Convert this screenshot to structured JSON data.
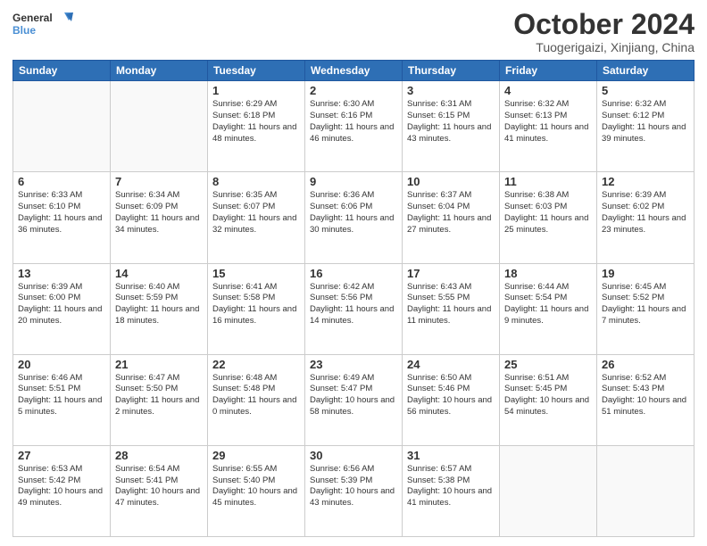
{
  "header": {
    "logo_line1": "General",
    "logo_line2": "Blue",
    "month": "October 2024",
    "location": "Tuogerigaizi, Xinjiang, China"
  },
  "days": [
    "Sunday",
    "Monday",
    "Tuesday",
    "Wednesday",
    "Thursday",
    "Friday",
    "Saturday"
  ],
  "weeks": [
    [
      {
        "num": "",
        "text": ""
      },
      {
        "num": "",
        "text": ""
      },
      {
        "num": "1",
        "text": "Sunrise: 6:29 AM\nSunset: 6:18 PM\nDaylight: 11 hours and 48 minutes."
      },
      {
        "num": "2",
        "text": "Sunrise: 6:30 AM\nSunset: 6:16 PM\nDaylight: 11 hours and 46 minutes."
      },
      {
        "num": "3",
        "text": "Sunrise: 6:31 AM\nSunset: 6:15 PM\nDaylight: 11 hours and 43 minutes."
      },
      {
        "num": "4",
        "text": "Sunrise: 6:32 AM\nSunset: 6:13 PM\nDaylight: 11 hours and 41 minutes."
      },
      {
        "num": "5",
        "text": "Sunrise: 6:32 AM\nSunset: 6:12 PM\nDaylight: 11 hours and 39 minutes."
      }
    ],
    [
      {
        "num": "6",
        "text": "Sunrise: 6:33 AM\nSunset: 6:10 PM\nDaylight: 11 hours and 36 minutes."
      },
      {
        "num": "7",
        "text": "Sunrise: 6:34 AM\nSunset: 6:09 PM\nDaylight: 11 hours and 34 minutes."
      },
      {
        "num": "8",
        "text": "Sunrise: 6:35 AM\nSunset: 6:07 PM\nDaylight: 11 hours and 32 minutes."
      },
      {
        "num": "9",
        "text": "Sunrise: 6:36 AM\nSunset: 6:06 PM\nDaylight: 11 hours and 30 minutes."
      },
      {
        "num": "10",
        "text": "Sunrise: 6:37 AM\nSunset: 6:04 PM\nDaylight: 11 hours and 27 minutes."
      },
      {
        "num": "11",
        "text": "Sunrise: 6:38 AM\nSunset: 6:03 PM\nDaylight: 11 hours and 25 minutes."
      },
      {
        "num": "12",
        "text": "Sunrise: 6:39 AM\nSunset: 6:02 PM\nDaylight: 11 hours and 23 minutes."
      }
    ],
    [
      {
        "num": "13",
        "text": "Sunrise: 6:39 AM\nSunset: 6:00 PM\nDaylight: 11 hours and 20 minutes."
      },
      {
        "num": "14",
        "text": "Sunrise: 6:40 AM\nSunset: 5:59 PM\nDaylight: 11 hours and 18 minutes."
      },
      {
        "num": "15",
        "text": "Sunrise: 6:41 AM\nSunset: 5:58 PM\nDaylight: 11 hours and 16 minutes."
      },
      {
        "num": "16",
        "text": "Sunrise: 6:42 AM\nSunset: 5:56 PM\nDaylight: 11 hours and 14 minutes."
      },
      {
        "num": "17",
        "text": "Sunrise: 6:43 AM\nSunset: 5:55 PM\nDaylight: 11 hours and 11 minutes."
      },
      {
        "num": "18",
        "text": "Sunrise: 6:44 AM\nSunset: 5:54 PM\nDaylight: 11 hours and 9 minutes."
      },
      {
        "num": "19",
        "text": "Sunrise: 6:45 AM\nSunset: 5:52 PM\nDaylight: 11 hours and 7 minutes."
      }
    ],
    [
      {
        "num": "20",
        "text": "Sunrise: 6:46 AM\nSunset: 5:51 PM\nDaylight: 11 hours and 5 minutes."
      },
      {
        "num": "21",
        "text": "Sunrise: 6:47 AM\nSunset: 5:50 PM\nDaylight: 11 hours and 2 minutes."
      },
      {
        "num": "22",
        "text": "Sunrise: 6:48 AM\nSunset: 5:48 PM\nDaylight: 11 hours and 0 minutes."
      },
      {
        "num": "23",
        "text": "Sunrise: 6:49 AM\nSunset: 5:47 PM\nDaylight: 10 hours and 58 minutes."
      },
      {
        "num": "24",
        "text": "Sunrise: 6:50 AM\nSunset: 5:46 PM\nDaylight: 10 hours and 56 minutes."
      },
      {
        "num": "25",
        "text": "Sunrise: 6:51 AM\nSunset: 5:45 PM\nDaylight: 10 hours and 54 minutes."
      },
      {
        "num": "26",
        "text": "Sunrise: 6:52 AM\nSunset: 5:43 PM\nDaylight: 10 hours and 51 minutes."
      }
    ],
    [
      {
        "num": "27",
        "text": "Sunrise: 6:53 AM\nSunset: 5:42 PM\nDaylight: 10 hours and 49 minutes."
      },
      {
        "num": "28",
        "text": "Sunrise: 6:54 AM\nSunset: 5:41 PM\nDaylight: 10 hours and 47 minutes."
      },
      {
        "num": "29",
        "text": "Sunrise: 6:55 AM\nSunset: 5:40 PM\nDaylight: 10 hours and 45 minutes."
      },
      {
        "num": "30",
        "text": "Sunrise: 6:56 AM\nSunset: 5:39 PM\nDaylight: 10 hours and 43 minutes."
      },
      {
        "num": "31",
        "text": "Sunrise: 6:57 AM\nSunset: 5:38 PM\nDaylight: 10 hours and 41 minutes."
      },
      {
        "num": "",
        "text": ""
      },
      {
        "num": "",
        "text": ""
      }
    ]
  ]
}
